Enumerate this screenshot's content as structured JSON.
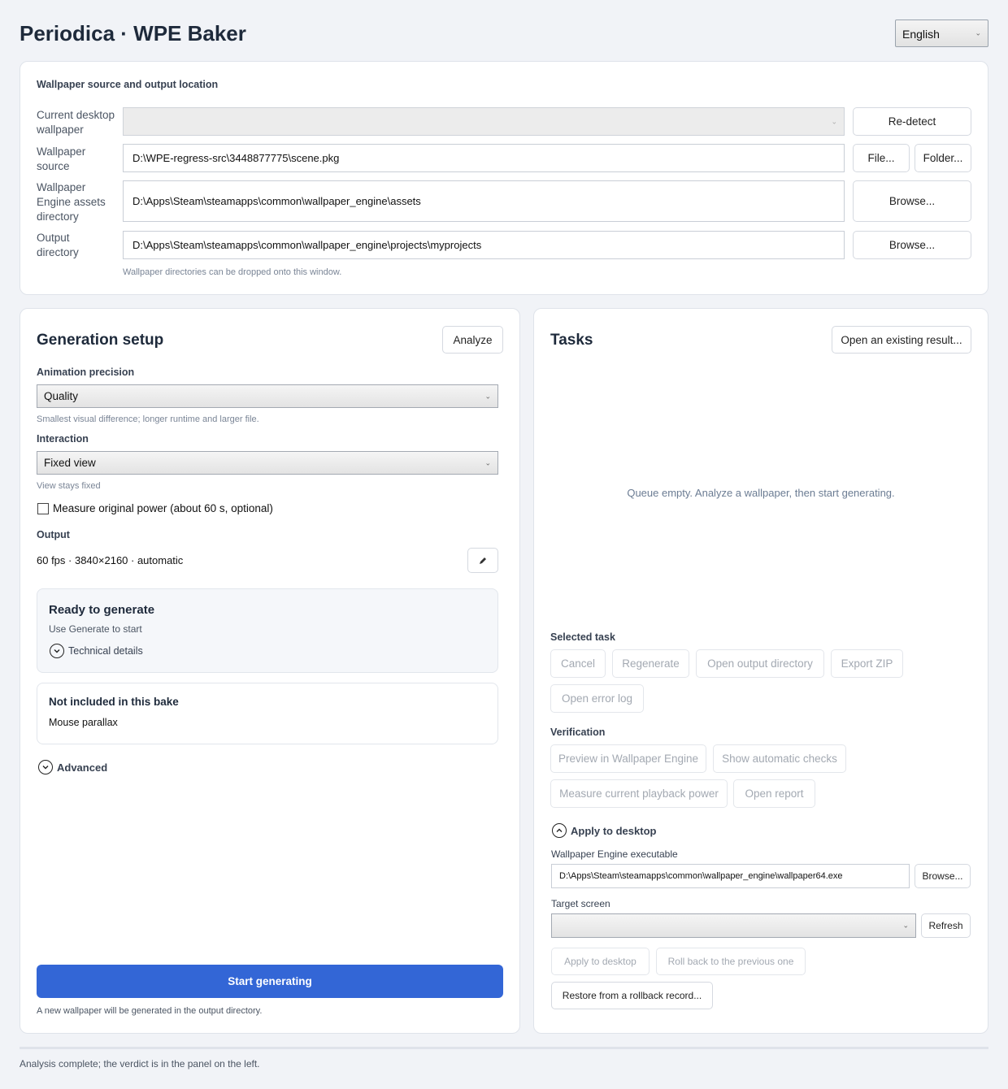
{
  "app": {
    "title": "Periodica · WPE Baker"
  },
  "language": {
    "selected": "English"
  },
  "source": {
    "heading": "Wallpaper source and output location",
    "current_label": "Current desktop wallpaper",
    "current_value": "",
    "redetect_label": "Re-detect",
    "source_label": "Wallpaper source",
    "source_value": "D:\\WPE-regress-src\\3448877775\\scene.pkg",
    "file_label": "File...",
    "folder_label": "Folder...",
    "assets_label": "Wallpaper Engine assets directory",
    "assets_value": "D:\\Apps\\Steam\\steamapps\\common\\wallpaper_engine\\assets",
    "assets_browse": "Browse...",
    "output_label": "Output directory",
    "output_value": "D:\\Apps\\Steam\\steamapps\\common\\wallpaper_engine\\projects\\myprojects",
    "output_browse": "Browse...",
    "drop_hint": "Wallpaper directories can be dropped onto this window."
  },
  "setup": {
    "title": "Generation setup",
    "analyze_label": "Analyze",
    "precision_label": "Animation precision",
    "precision_value": "Quality",
    "precision_hint": "Smallest visual difference; longer runtime and larger file.",
    "interaction_label": "Interaction",
    "interaction_value": "Fixed view",
    "interaction_hint": "View stays fixed",
    "measure_label": "Measure original power (about 60 s, optional)",
    "output_label": "Output",
    "output_value": "60 fps · 3840×2160 · automatic",
    "ready_title": "Ready to generate",
    "ready_sub": "Use Generate to start",
    "tech_label": "Technical details",
    "excluded_title": "Not included in this bake",
    "excluded_item": "Mouse parallax",
    "advanced_label": "Advanced",
    "start_label": "Start generating",
    "start_hint": "A new wallpaper will be generated in the output directory."
  },
  "tasks": {
    "title": "Tasks",
    "open_label": "Open an existing result...",
    "empty_text": "Queue empty. Analyze a wallpaper, then start generating.",
    "selected_label": "Selected task",
    "cancel": "Cancel",
    "regenerate": "Regenerate",
    "open_output": "Open output directory",
    "export_zip": "Export ZIP",
    "open_error_log": "Open error log",
    "verification_label": "Verification",
    "preview": "Preview in Wallpaper Engine",
    "show_checks": "Show automatic checks",
    "measure_power": "Measure current playback power",
    "open_report": "Open report",
    "apply_section": "Apply to desktop",
    "exe_label": "Wallpaper Engine executable",
    "exe_value": "D:\\Apps\\Steam\\steamapps\\common\\wallpaper_engine\\wallpaper64.exe",
    "exe_browse": "Browse...",
    "screen_label": "Target screen",
    "screen_value": "",
    "refresh": "Refresh",
    "apply": "Apply to desktop",
    "rollback": "Roll back to the previous one",
    "restore": "Restore from a rollback record..."
  },
  "status": {
    "text": "Analysis complete; the verdict is in the panel on the left."
  }
}
